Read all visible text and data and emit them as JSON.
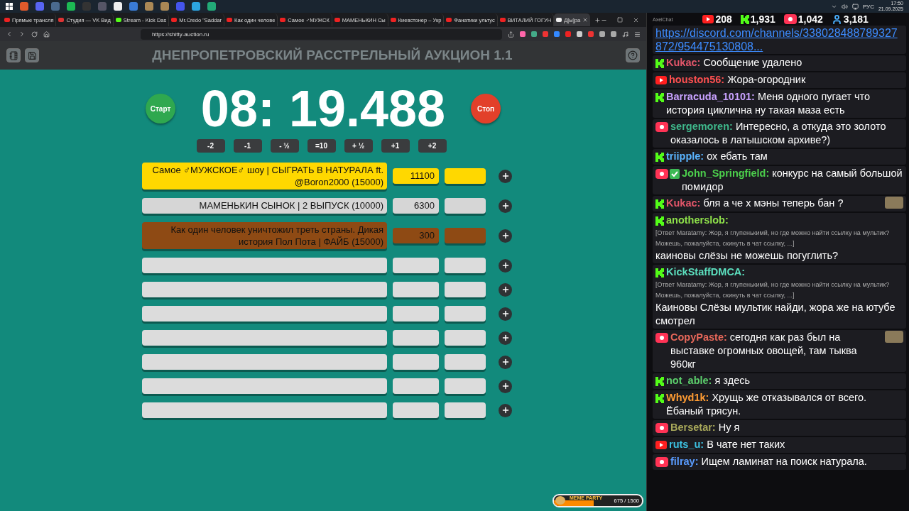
{
  "tray": {
    "language": "РУС",
    "time": "17:50",
    "date": "21.09.2025"
  },
  "browser": {
    "tabs": [
      {
        "label": "Прямые трансля",
        "selected": false
      },
      {
        "label": "Студия — VK Вид",
        "selected": false
      },
      {
        "label": "Stream - Kick Das",
        "selected": false
      },
      {
        "label": "Mr.Credo \"Saddar",
        "selected": false
      },
      {
        "label": "Как один челове",
        "selected": false
      },
      {
        "label": "Самое ♂МУЖСК",
        "selected": false
      },
      {
        "label": "МАМЕНЬКИН Сы",
        "selected": false
      },
      {
        "label": "Киевстонер – Укр",
        "selected": false
      },
      {
        "label": "Фанатики ультус",
        "selected": false
      },
      {
        "label": "ВИТАЛИЙ ГОГУН",
        "selected": false
      },
      {
        "label": "Д[ы]ра",
        "selected": true
      }
    ],
    "url": "https://shitty-auction.ru"
  },
  "auction": {
    "title": "ДНЕПРОПЕТРОВСКИЙ РАССТРЕЛЬНЫЙ АУКЦИОН 1.1",
    "start_label": "Старт",
    "stop_label": "Стоп",
    "timer": "08: 19.488",
    "time_buttons": [
      "-2",
      "-1",
      "- ½",
      "=10",
      "+ ½",
      "+1",
      "+2"
    ],
    "lots": [
      {
        "title": "Самое ♂МУЖСКОЕ♂ шоу | СЫГРАТЬ В НАТУРАЛА ft. @Boron2000 (15000)",
        "amount": "11100",
        "color": "#ffd800"
      },
      {
        "title": "МАМЕНЬКИН СЫНОК | 2 ВЫПУСК (10000)",
        "amount": "6300",
        "color": "#d6d6d6"
      },
      {
        "title": "Как один человек уничтожил треть страны. Дикая история Пол Пота | ФАЙБ (15000)",
        "amount": "300",
        "color": "#8e4a14"
      },
      {
        "color": "#dcdcdc"
      },
      {
        "color": "#dcdcdc"
      },
      {
        "color": "#dcdcdc"
      },
      {
        "color": "#dcdcdc"
      },
      {
        "color": "#dcdcdc"
      },
      {
        "color": "#dcdcdc"
      },
      {
        "color": "#dcdcdc"
      }
    ]
  },
  "widget": {
    "title": "MEME PARTY",
    "reading": "675 / 1500",
    "level": 0.45
  },
  "chat": {
    "app_title": "AxelChat",
    "stats": [
      {
        "kind": "youtube",
        "count": "208"
      },
      {
        "kind": "kick",
        "count": "1,931"
      },
      {
        "kind": "vklive",
        "count": "1,042"
      },
      {
        "kind": "viewers",
        "count": "3,181"
      }
    ],
    "link": "https://discord.com/channels/338028488789327872/954475130808...",
    "messages": [
      {
        "kind": "kick",
        "author": "Kukac:",
        "color": "#e4566a",
        "text": "Сообщение удалено"
      },
      {
        "kind": "youtube",
        "author": "houston56:",
        "color": "#ff5050",
        "text": "Жора-огородник"
      },
      {
        "kind": "kick",
        "author": "Barracuda_10101:",
        "color": "#c9a2ff",
        "text": "Меня одного пугает что история циклична ну такая маза есть"
      },
      {
        "kind": "vklive",
        "author": "sergemoren:",
        "color": "#3fb98c",
        "text": "Интересно, а откуда это золото оказалось в латышском архиве?)"
      },
      {
        "kind": "kick",
        "author": "triipple:",
        "color": "#5ab4ff",
        "text": "ох ебать там"
      },
      {
        "kind": "vklive",
        "author": "John_Springfield:",
        "color": "#4ccf4c",
        "badge": true,
        "text": "конкурс на самый большой помидор"
      },
      {
        "kind": "kick",
        "author": "Kukac:",
        "color": "#e4566a",
        "text": "бля а че х мэны теперь бан ?",
        "emote": true
      },
      {
        "kind": "kick",
        "author": "anotherslob:",
        "color": "#8ee04a",
        "reply": "[Ответ Maratamy: Жор, я глупенькимй, но где можно найти ссылку на мультик? Можешь, пожалуйста, скинуть в чат ссылку, ...]",
        "text": "каиновы слёзы не можешь погуглить?"
      },
      {
        "kind": "kick",
        "author": "KickStaffDMCA:",
        "color": "#5ce0bf",
        "reply": "[Ответ Maratamy: Жор, я глупенькимй, но где можно найти ссылку на мультик? Можешь, пожалуйста, скинуть в чат ссылку, ...]",
        "text": "Каиновы Слёзы мультик найди, жора же на ютубе смотрел"
      },
      {
        "kind": "vklive",
        "author": "CopyPaste:",
        "color": "#e8685a",
        "text": "сегодня как раз был на выставке огромных овощей, там тыква 960кг",
        "emote": true
      },
      {
        "kind": "kick",
        "author": "not_able:",
        "color": "#5ccf6c",
        "text": "я здесь"
      },
      {
        "kind": "kick",
        "author": "Whyd1k:",
        "color": "#ff9c33",
        "text": "Хрущь же отказывался от всего. Ёбаный трясун."
      },
      {
        "kind": "vklive",
        "author": "Bersetar:",
        "color": "#a8a85a",
        "text": "Ну я"
      },
      {
        "kind": "youtube",
        "author": "ruts_u:",
        "color": "#3cc0e0",
        "text": "В чате нет таких"
      },
      {
        "kind": "vklive",
        "author": "filray:",
        "color": "#5a9cff",
        "text": "Ищем ламинат на поиск натурала."
      }
    ]
  }
}
